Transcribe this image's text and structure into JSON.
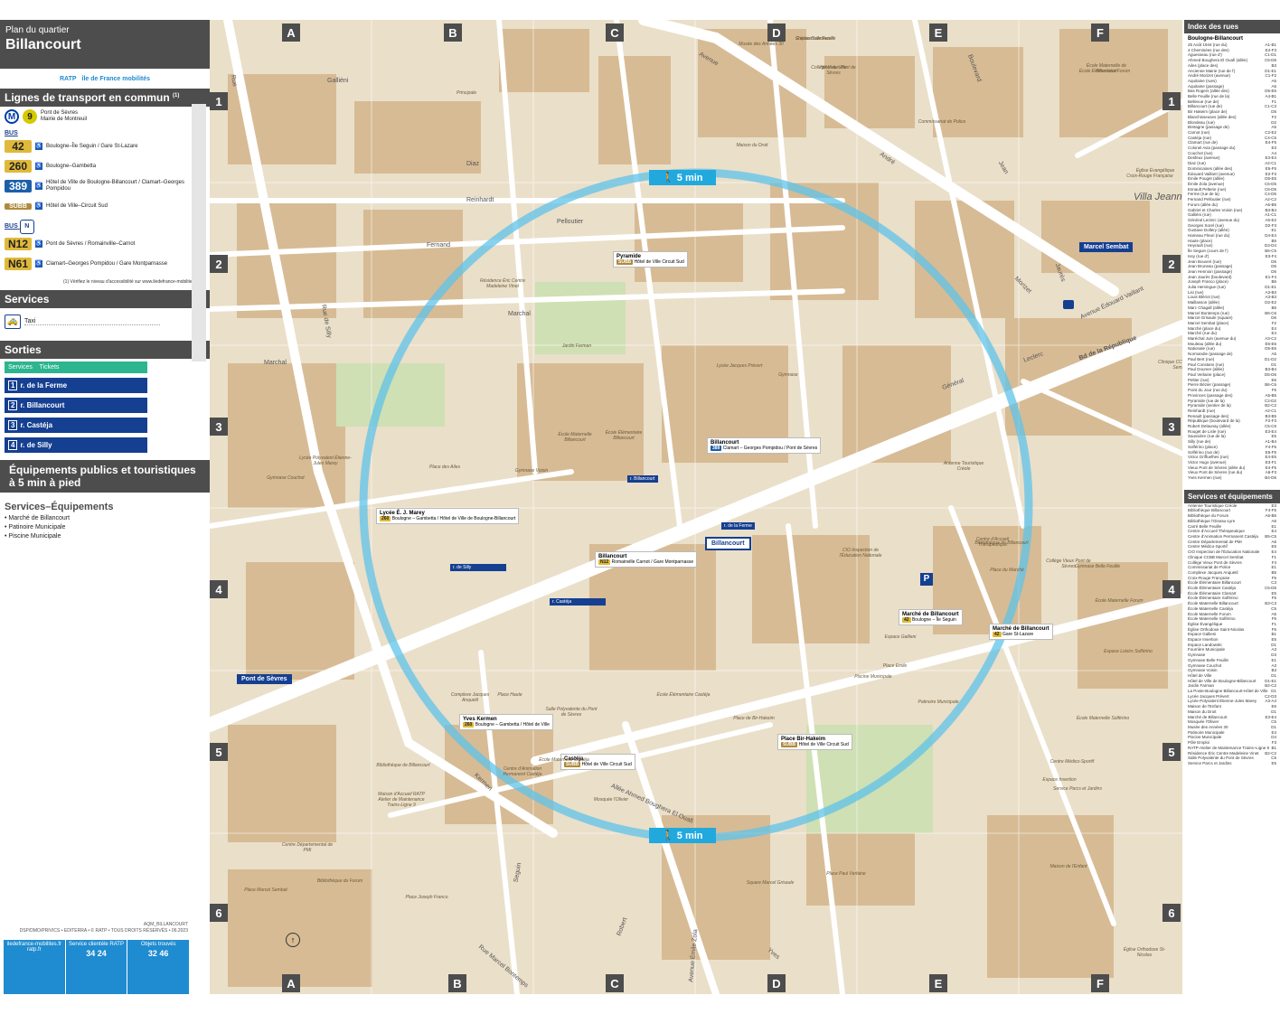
{
  "header": {
    "subtitle": "Plan du quartier",
    "title": "Billancourt"
  },
  "logos": {
    "ratp": "RATP",
    "idf": "île de France mobilités"
  },
  "sections": {
    "transport": "Lignes de transport en commun",
    "transport_note": "(1)",
    "services": "Services",
    "sorties": "Sorties",
    "equipements": "Équipements publics et touristiques à 5 min à pied",
    "eq_services": "Services–Équipements"
  },
  "metro": {
    "line": "9",
    "dest": "Pont de Sèvres\nMairie de Montreuil"
  },
  "bus_tag": "BUS",
  "buses": [
    {
      "num": "42",
      "dest": "Boulogne–Île Seguin / Gare St-Lazare",
      "cls": "b42"
    },
    {
      "num": "260",
      "dest": "Boulogne–Gambetta",
      "cls": "b260"
    },
    {
      "num": "389",
      "dest": "Hôtel de Ville de Boulogne-Billancourt / Clamart–Georges Pompidou",
      "cls": "b389"
    },
    {
      "num": "SUBB",
      "dest": "Hôtel de Ville–Circuit Sud",
      "cls": "bsubb"
    }
  ],
  "noctilien": [
    {
      "num": "N12",
      "dest": "Pont de Sèvres / Romainville–Carnot"
    },
    {
      "num": "N61",
      "dest": "Clamart–Georges Pompidou / Gare Montparnasse"
    }
  ],
  "access_note": "(1) Vérifiez le niveau d'accessibilité sur www.iledefrance-mobilites.fr",
  "services": {
    "taxi": "Taxi"
  },
  "sorties": {
    "head_services": "Services",
    "head_tickets": "Tickets",
    "items": [
      {
        "n": "1",
        "label": "r. de la Ferme"
      },
      {
        "n": "2",
        "label": "r. Billancourt"
      },
      {
        "n": "3",
        "label": "r. Castéja"
      },
      {
        "n": "4",
        "label": "r. de Silly"
      }
    ]
  },
  "equipements": [
    "Marché de Billancourt",
    "Patinoire Municipale",
    "Piscine Municipale"
  ],
  "footer": {
    "copyright": "AQM_BILLANCOURT\nDSP/DMO/PRIVICS • EDITERRA • © RATP • TOUS DROITS RÉSERVÉS • 06.2023",
    "c1": "iledefrance-mobilites.fr\nratp.fr",
    "c2": "Service clientèle RATP",
    "c2n": "34 24",
    "c3": "Objets trouvés",
    "c3n": "32 46"
  },
  "map": {
    "cols": [
      "A",
      "B",
      "C",
      "D",
      "E",
      "F"
    ],
    "rows": [
      "1",
      "2",
      "3",
      "4",
      "5",
      "6"
    ],
    "walk": "5 min",
    "stations": [
      {
        "name": "Marcel Sembat"
      },
      {
        "name": "Billancourt"
      },
      {
        "name": "Pont de Sèvres"
      }
    ],
    "exits_map": [
      "r. Billancourt",
      "r. de Silly",
      "r. Castéja",
      "r. de la Ferme"
    ],
    "stops": [
      {
        "name": "Pyramide",
        "lines": "Hôtel de Ville Circuit Sud"
      },
      {
        "name": "Billancourt",
        "lines": "Clamart – Georges Pompidou / Pont de Sèvres"
      },
      {
        "name": "Lycée É. J. Marey",
        "lines": "Boulogne – Gambetta / Hôtel de Ville de Boulogne-Billancourt"
      },
      {
        "name": "Billancourt",
        "lines": "Romainville Carnot / Gare Montparnasse"
      },
      {
        "name": "Marché de Billancourt",
        "lines": "Boulogne – Île Seguin"
      },
      {
        "name": "Marché de Billancourt",
        "lines": "Gare St-Lazare"
      },
      {
        "name": "Yves Kermen",
        "lines": "Boulogne – Gambetta / Hôtel de Ville"
      },
      {
        "name": "Place Bir-Hakeim",
        "lines": "Hôtel de Ville Circuit Sud"
      },
      {
        "name": "Castéja",
        "lines": "Hôtel de Ville Circuit Sud"
      }
    ],
    "streets": [
      "Avenue",
      "André",
      "Morizet",
      "Bd de la République",
      "Général",
      "Leclerc",
      "Avenue Édouard Vaillant",
      "Rue de Silly",
      "Rue",
      "Galliéni",
      "Diaz",
      "Reinhardt",
      "Pelloutier",
      "Fernand",
      "Marchal",
      "Marchal",
      "Allée Ahmed Boughera El Ouafi",
      "Kermen",
      "Rue Marcel Bontemps",
      "Avenue Émile Zola",
      "Yves",
      "Robert",
      "Seguin",
      "Boulevard",
      "Jean",
      "Villa Jeanne",
      "Jaurès"
    ],
    "pois": [
      "Espace Landowski",
      "Hôtel de Ville",
      "Musée des Années 30",
      "Commissariat de Police",
      "Maison du Droit",
      "Résidence Éric Centre Madeleine Vinet",
      "Jardin Farman",
      "Lycée Jacques Prévert",
      "Gymnase",
      "École Maternelle Billancourt",
      "École Élémentaire Billancourt",
      "Lycée Polyvalent Étienne-Jules Marey",
      "Gymnase Couchot",
      "Gymnase Voisin",
      "Place des Ailes",
      "Antenne Touristique Créole",
      "Bibliothèque de Billancourt",
      "Centre d'Accueil Thérapeutique",
      "CIO Inspection de l'Éducation Nationale",
      "Place du Marché",
      "Collège Vieux Pont de Sèvres",
      "École Élémentaire Castéja",
      "Piscine Municipale",
      "Patinoire Municipale",
      "Complexe Jacques Anquetil",
      "Place Haute",
      "Salle Polyvalente du Pont de Sèvres",
      "École Maternelle Castéja",
      "Mosquée l'Olivier",
      "Centre d'Animation Permanent Castéja",
      "Place de Bir-Hakeim",
      "Espace Gallieni",
      "École Maternelle Solférino",
      "Centre Médico-Sportif",
      "Espace Insertion",
      "Service Parcs et Jardins",
      "Centre Départemental de PMI",
      "Bibliothèque du Forum",
      "Maison de l'Enfant",
      "Place Joseph Franco",
      "Square Marcel Grisaule",
      "Place Paul Verlaine",
      "Église Orthodoxe St-Nicolas",
      "Espace Loisirs Solférino",
      "Croix-Rouge Française",
      "Église Évangélique",
      "Clinique CCBB Marcel Sembat",
      "Place Marcel Sembat",
      "Place Emile",
      "Principale",
      "Bibliothèque de Billancourt",
      "Maison d'Accueil RATP Atelier de Maintenance Trains-Ligne 9",
      "École Maternelle Forum",
      "École Élémentaire Forum",
      "École Maternelle de Billancourt",
      "Gymnase Belle Feuille",
      "Crèche Belle Feuille",
      "Collège Vieux Pont de Sèvres"
    ]
  },
  "index": {
    "title": "Index des rues",
    "sub": "Boulogne-Billancourt",
    "streets": [
      [
        "25 Août 1944 (rue du)",
        "A1-B1"
      ],
      [
        "4 Cheminées (rue des)",
        "E4-F3"
      ],
      [
        "Aguesseau (rue d')",
        "C1-D1"
      ],
      [
        "Ahmed Boughera El Ouafi (allée)",
        "C5-D6"
      ],
      [
        "Ailes (place des)",
        "B3"
      ],
      [
        "Ancienne Mairie (rue de l')",
        "D1-E1"
      ],
      [
        "André Morizet (avenue)",
        "C1-F2"
      ],
      [
        "Aquitaine (rues)",
        "A5"
      ],
      [
        "Aquitaine (passage)",
        "A5"
      ],
      [
        "Bas Rogers (allée des)",
        "D5-E5"
      ],
      [
        "Belle Feuille (rue de la)",
        "A4-B1"
      ],
      [
        "Bellevue (rue de)",
        "F1"
      ],
      [
        "Billancourt (rue de)",
        "C1-C3"
      ],
      [
        "Bir Hakeim (place de)",
        "D5"
      ],
      [
        "Blanchisseuses (allée des)",
        "F2"
      ],
      [
        "Blondeau (rue)",
        "D2"
      ],
      [
        "Bretagne (passage de)",
        "A5"
      ],
      [
        "Carnot (rue)",
        "C2-E2"
      ],
      [
        "Castéja (rue)",
        "C4-C5"
      ],
      [
        "Clamart (rue de)",
        "E4-F5"
      ],
      [
        "Colonel Avia (passage du)",
        "E3"
      ],
      [
        "Couchot (rue)",
        "A4"
      ],
      [
        "Desfeux (avenue)",
        "E3-E4"
      ],
      [
        "Diaz (rue)",
        "A2-C1"
      ],
      [
        "Dominicaines (allée des)",
        "E5-F5"
      ],
      [
        "Édouard Vaillant (avenue)",
        "E2-F3"
      ],
      [
        "Émile Pouget (allée)",
        "D5-E5"
      ],
      [
        "Émile Zola (avenue)",
        "C6-D5"
      ],
      [
        "Esnault Pelterie (rue)",
        "C6-D5"
      ],
      [
        "Ferme (rue de la)",
        "C4-D5"
      ],
      [
        "Fernand Pelloutier (rue)",
        "A2-C2"
      ],
      [
        "Forum (allée du)",
        "A6-B5"
      ],
      [
        "Gabriel et Charles Voisin (rue)",
        "B3-B4"
      ],
      [
        "Galliéni (rue)",
        "A1-C1"
      ],
      [
        "Général Leclerc (avenue du)",
        "A5-E2"
      ],
      [
        "Georges Sorel (rue)",
        "D2-F3"
      ],
      [
        "Gustave Dollery (allée)",
        "E1"
      ],
      [
        "Hameau Fleuri (rue du)",
        "D4-E4"
      ],
      [
        "Haute (place)",
        "B5"
      ],
      [
        "Heyrault (rue)",
        "D3-D4"
      ],
      [
        "Île Seguin (cours de l')",
        "B6-C5"
      ],
      [
        "Issy (rue d')",
        "E3-F4"
      ],
      [
        "Jean Bouveri (rue)",
        "D6"
      ],
      [
        "Jean Bruneau (passage)",
        "D6"
      ],
      [
        "Jean Hennion (passage)",
        "D6"
      ],
      [
        "Jean Jaurès (boulevard)",
        "E1-F4"
      ],
      [
        "Joseph Franco (place)",
        "B6"
      ],
      [
        "Julia Hemingue (rue)",
        "D1-E1"
      ],
      [
        "Lisi (rue)",
        "A3-B3"
      ],
      [
        "Louis Blériot (rue)",
        "A3-B3"
      ],
      [
        "Maillasson (allée)",
        "D2-E2"
      ],
      [
        "Marc Chagall (allée)",
        "B6"
      ],
      [
        "Marcel Bontemps (rue)",
        "B6-C6"
      ],
      [
        "Marcel Grisaule (square)",
        "D6"
      ],
      [
        "Marcel Sembat (place)",
        "F2"
      ],
      [
        "Marché (place du)",
        "E4"
      ],
      [
        "Marché (rue du)",
        "E4"
      ],
      [
        "Maréchal Juin (avenue du)",
        "A3-C2"
      ],
      [
        "Mouleau (allée du)",
        "E5-E6"
      ],
      [
        "Nationale (rue)",
        "D5-E6"
      ],
      [
        "Normandie (passage de)",
        "A5"
      ],
      [
        "Paul Bert (rue)",
        "D1-D2"
      ],
      [
        "Paul Constans (rue)",
        "D1"
      ],
      [
        "Paul Doumer (allée)",
        "B3-B4"
      ],
      [
        "Paul Verlaine (place)",
        "D5-D6"
      ],
      [
        "Peltier (rue)",
        "E6"
      ],
      [
        "Pierre Bézier (passage)",
        "B6-C6"
      ],
      [
        "Point du Jour (rue du)",
        "F5"
      ],
      [
        "Provinces (passage des)",
        "A5-B5"
      ],
      [
        "Pyramide (rue de la)",
        "C2-D2"
      ],
      [
        "Pyramide (sentier de la)",
        "B2-C2"
      ],
      [
        "Reinhardt (rue)",
        "A2-C1"
      ],
      [
        "Renault (passage des)",
        "B3-B5"
      ],
      [
        "République (boulevard de la)",
        "F2-F3"
      ],
      [
        "Robert Delaunay (allée)",
        "C5-C6"
      ],
      [
        "Rouget de Lisle (rue)",
        "E3-E4"
      ],
      [
        "Saussière (rue de la)",
        "E5"
      ],
      [
        "Silly (rue de)",
        "A1-B4"
      ],
      [
        "Solférino (place)",
        "F4-F5"
      ],
      [
        "Solférino (rue de)",
        "E5-F5"
      ],
      [
        "Victor Griffuelhes (rue)",
        "E4-E5"
      ],
      [
        "Victor Hugo (avenue)",
        "E3-F1"
      ],
      [
        "Vieux Pont de Sèvres (allée du)",
        "E4-F5"
      ],
      [
        "Vieux Pont de Sèvres (rue du)",
        "A6-F3"
      ],
      [
        "Yves Kermen (rue)",
        "B4-D6"
      ]
    ],
    "services_title": "Services et équipements",
    "services": [
      [
        "Antenne Touristique Créole",
        "E3"
      ],
      [
        "Bibliothèque Billancourt",
        "F4-F5"
      ],
      [
        "Bibliothèque du Forum",
        "A6-B6"
      ],
      [
        "Bibliothèque l'Oiseau-Lyre",
        "A6"
      ],
      [
        "Carré Belle Feuille",
        "E1"
      ],
      [
        "Centre d'Accueil Thérapeutique",
        "E4"
      ],
      [
        "Centre d'Animation Permanent Castéja",
        "B5-C5"
      ],
      [
        "Centre Départemental de PMI",
        "A6"
      ],
      [
        "Centre Médico-Sportif",
        "E5"
      ],
      [
        "CIO Inspection de l'Éducation Nationale",
        "E4"
      ],
      [
        "Clinique CCBB Marcel Sembat",
        "F1"
      ],
      [
        "Collège Vieux Pont de Sèvres",
        "F4"
      ],
      [
        "Commissariat de Police",
        "E1"
      ],
      [
        "Complexe Jacques Anquetil",
        "B5"
      ],
      [
        "Croix-Rouge Française",
        "F5"
      ],
      [
        "École Élémentaire Billancourt",
        "C3"
      ],
      [
        "École Élémentaire Castéja",
        "C5-D5"
      ],
      [
        "École Élémentaire Clamart",
        "E5"
      ],
      [
        "École Élémentaire Solférino",
        "F5"
      ],
      [
        "École Maternelle Billancourt",
        "B3-C3"
      ],
      [
        "École Maternelle Castéja",
        "C5"
      ],
      [
        "École Maternelle Forum",
        "A5"
      ],
      [
        "École Maternelle Solférino",
        "F5"
      ],
      [
        "Église Évangélique",
        "F1"
      ],
      [
        "Église Orthodoxe Saint-Nicolas",
        "F6"
      ],
      [
        "Espace Gallieni",
        "B1"
      ],
      [
        "Espace Insertion",
        "E5"
      ],
      [
        "Espace Landowski",
        "D1"
      ],
      [
        "Fourrière Municipale",
        "A3"
      ],
      [
        "Gymnase",
        "D3"
      ],
      [
        "Gymnase Belle Feuille",
        "E1"
      ],
      [
        "Gymnase Couchot",
        "A3"
      ],
      [
        "Gymnase Voisin",
        "B3"
      ],
      [
        "Hôtel de Ville",
        "D1"
      ],
      [
        "Hôtel de Ville de Boulogne-Billancourt",
        "D1-E1"
      ],
      [
        "Jardin Farman",
        "B2-C2"
      ],
      [
        "La Poste-Boulogne Billancourt-Hôtel de Ville",
        "D1"
      ],
      [
        "Lycée Jacques Prévert",
        "C2-D3"
      ],
      [
        "Lycée Polyvalent Étienne-Jules Marey",
        "A3-A4"
      ],
      [
        "Maison de l'Enfant",
        "E6"
      ],
      [
        "Maison du Droit",
        "D1"
      ],
      [
        "Marché de Billancourt",
        "E3-E4"
      ],
      [
        "Mosquée l'Olivier",
        "C5"
      ],
      [
        "Musée des Années 30",
        "D1"
      ],
      [
        "Patinoire Municipale",
        "E4"
      ],
      [
        "Piscine Municipale",
        "D4"
      ],
      [
        "Pôle Emploi",
        "F3"
      ],
      [
        "RATP-Atelier de Maintenance Trains–Ligne 9",
        "B1"
      ],
      [
        "Résidence Éric Centre Madeleine Vinet",
        "B2-C2"
      ],
      [
        "Salle Polyvalente du Pont de Sèvres",
        "C5"
      ],
      [
        "Service Parcs et Jardins",
        "E5"
      ]
    ]
  }
}
